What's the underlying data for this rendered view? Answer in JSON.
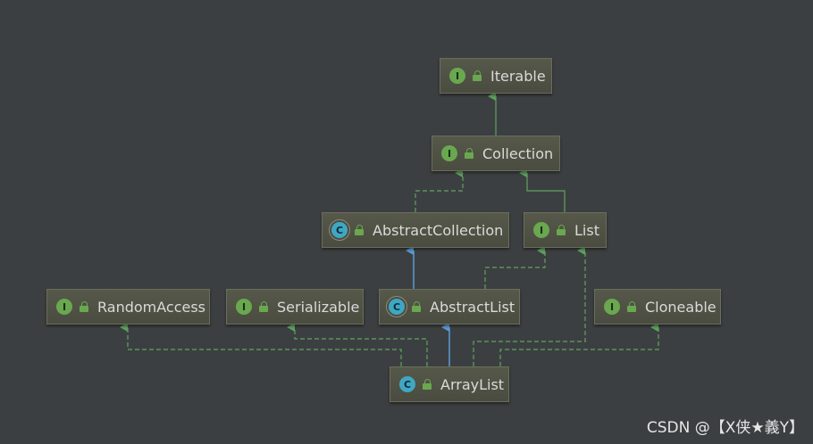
{
  "nodes": {
    "iterable": {
      "label": "Iterable",
      "kind": "I"
    },
    "collection": {
      "label": "Collection",
      "kind": "I"
    },
    "abstract_collection": {
      "label": "AbstractCollection",
      "kind": "C"
    },
    "list": {
      "label": "List",
      "kind": "I"
    },
    "random_access": {
      "label": "RandomAccess",
      "kind": "I"
    },
    "serializable": {
      "label": "Serializable",
      "kind": "I"
    },
    "abstract_list": {
      "label": "AbstractList",
      "kind": "C"
    },
    "cloneable": {
      "label": "Cloneable",
      "kind": "I"
    },
    "array_list": {
      "label": "ArrayList",
      "kind": "C"
    }
  },
  "colors": {
    "background": "#3c3f41",
    "extends_edge": "#5b9bd5",
    "implements_edge": "#5fa35f",
    "interface_badge": "#6aa84f",
    "class_badge": "#3fa7c4"
  },
  "watermark": "CSDN @【X侠★義Y】"
}
